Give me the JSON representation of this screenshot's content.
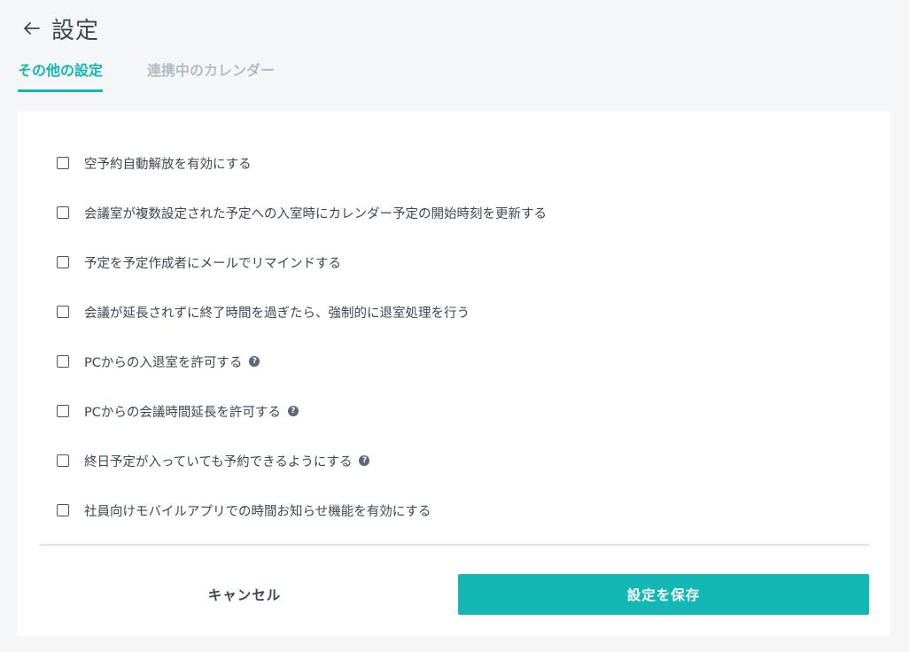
{
  "header": {
    "title": "設定"
  },
  "tabs": [
    {
      "label": "その他の設定",
      "active": true
    },
    {
      "label": "連携中のカレンダー",
      "active": false
    }
  ],
  "options": [
    {
      "label": "空予約自動解放を有効にする",
      "checked": false,
      "help": false
    },
    {
      "label": "会議室が複数設定された予定への入室時にカレンダー予定の開始時刻を更新する",
      "checked": false,
      "help": false
    },
    {
      "label": "予定を予定作成者にメールでリマインドする",
      "checked": false,
      "help": false
    },
    {
      "label": "会議が延長されずに終了時間を過ぎたら、強制的に退室処理を行う",
      "checked": false,
      "help": false
    },
    {
      "label": "PCからの入退室を許可する",
      "checked": false,
      "help": true
    },
    {
      "label": "PCからの会議時間延長を許可する",
      "checked": false,
      "help": true
    },
    {
      "label": "終日予定が入っていても予約できるようにする",
      "checked": false,
      "help": true
    },
    {
      "label": "社員向けモバイルアプリでの時間お知らせ機能を有効にする",
      "checked": false,
      "help": false
    }
  ],
  "help_icon_glyph": "?",
  "footer": {
    "cancel_label": "キャンセル",
    "save_label": "設定を保存"
  },
  "colors": {
    "accent": "#16b6b1",
    "text": "#3d4852",
    "inactive_tab": "#b3bcc4",
    "background": "#f5f6f7"
  }
}
